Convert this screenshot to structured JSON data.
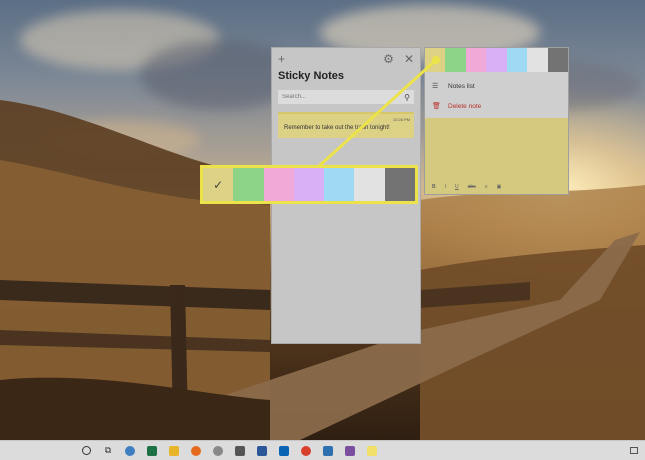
{
  "sticky_notes": {
    "title": "Sticky Notes",
    "add_icon": "plus-icon",
    "settings_icon": "gear-icon",
    "close_icon": "close-icon",
    "search_placeholder": "Search...",
    "note": {
      "time": "10:28 PM",
      "text": "Remember to take out the trash tonight!"
    }
  },
  "note_menu": {
    "colors": [
      {
        "name": "yellow",
        "hex": "#ddd186",
        "selected": true
      },
      {
        "name": "green",
        "hex": "#8ed488"
      },
      {
        "name": "pink",
        "hex": "#f1a9d7"
      },
      {
        "name": "purple",
        "hex": "#d9b0f6"
      },
      {
        "name": "blue",
        "hex": "#9fdaf5"
      },
      {
        "name": "gray",
        "hex": "#e2e2e2"
      },
      {
        "name": "charcoal",
        "hex": "#737373"
      }
    ],
    "items": [
      {
        "label": "Notes list",
        "icon": "list-icon"
      },
      {
        "label": "Delete note",
        "icon": "trash-icon"
      }
    ],
    "format_icons": [
      "bold-icon",
      "italic-icon",
      "underline-icon",
      "strikethrough-icon",
      "bullets-icon",
      "image-icon"
    ],
    "format_glyphs": [
      "B",
      "I",
      "U",
      "abc",
      "≡",
      "▣"
    ]
  },
  "callout": {
    "colors": [
      "#ddd186",
      "#8ed488",
      "#f1a9d7",
      "#d9b0f6",
      "#9fdaf5",
      "#e2e2e2",
      "#737373"
    ],
    "border_color": "#ece34a",
    "check": "✓"
  },
  "taskbar": {
    "icons": [
      "cortana-icon",
      "task-view-icon",
      "edge-icon",
      "excel-icon",
      "file-explorer-icon",
      "firefox-icon",
      "media-player-icon",
      "photos-icon",
      "word-icon",
      "outlook-icon",
      "chrome-icon",
      "security-icon",
      "onenote-icon",
      "sticky-notes-icon"
    ]
  }
}
